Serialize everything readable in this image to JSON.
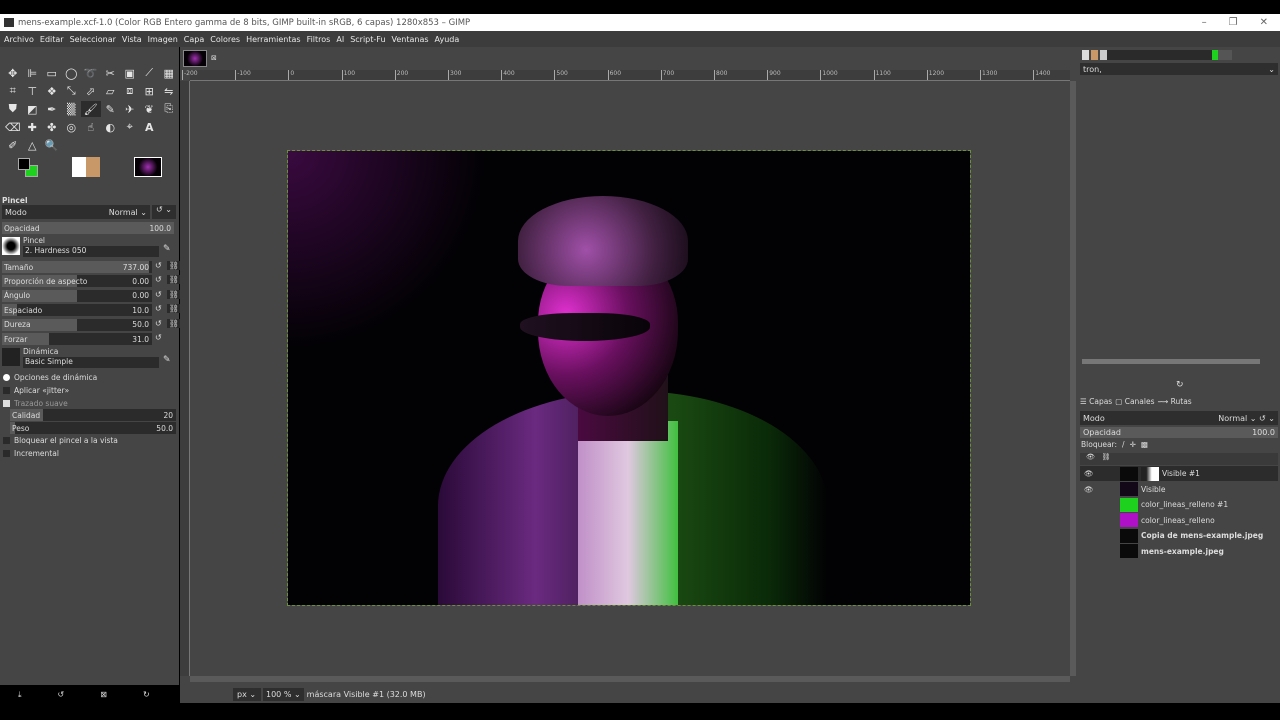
{
  "window": {
    "title": "mens-example.xcf-1.0 (Color RGB Entero gamma de 8 bits, GIMP built-in sRGB, 6 capas) 1280x853 – GIMP",
    "minimize": "–",
    "maximize": "❐",
    "close": "✕"
  },
  "menu": [
    "Archivo",
    "Editar",
    "Seleccionar",
    "Vista",
    "Imagen",
    "Capa",
    "Colores",
    "Herramientas",
    "Filtros",
    "AI",
    "Script-Fu",
    "Ventanas",
    "Ayuda"
  ],
  "tool_options": {
    "title": "Pincel",
    "mode_label": "Modo",
    "mode_value": "Normal",
    "opacity_label": "Opacidad",
    "opacity_value": "100.0",
    "brush_label": "Pincel",
    "brush_value": "2. Hardness 050",
    "sliders": [
      {
        "label": "Tamaño",
        "value": "737.00",
        "fraction": 0.98
      },
      {
        "label": "Proporción de aspecto",
        "value": "0.00",
        "fraction": 0.5
      },
      {
        "label": "Ángulo",
        "value": "0.00",
        "fraction": 0.5
      },
      {
        "label": "Espaciado",
        "value": "10.0",
        "fraction": 0.1
      },
      {
        "label": "Dureza",
        "value": "50.0",
        "fraction": 0.5
      },
      {
        "label": "Forzar",
        "value": "31.0",
        "fraction": 0.31
      }
    ],
    "dynamics_label": "Dinámica",
    "dynamics_value": "Basic Simple",
    "dynamics_options": "Opciones de dinámica",
    "jitter": "Aplicar «jitter»",
    "smooth": "Trazado suave",
    "quality_label": "Calidad",
    "quality_value": "20",
    "quality_fraction": 0.2,
    "weight_label": "Peso",
    "weight_value": "50.0",
    "weight_fraction": 0.03,
    "lock_brush": "Bloquear el pincel a la vista",
    "incremental": "Incremental"
  },
  "ruler": [
    "-200",
    "-100",
    "0",
    "100",
    "200",
    "300",
    "400",
    "500",
    "600",
    "700",
    "800",
    "900",
    "1000",
    "1100",
    "1200",
    "1300",
    "1400"
  ],
  "right_panel": {
    "brush_dropdown": "tron,",
    "tabs": [
      "Capas",
      "Canales",
      "Rutas"
    ],
    "mode_label": "Modo",
    "mode_value": "Normal",
    "opacity_label": "Opacidad",
    "opacity_value": "100.0",
    "lock_label": "Bloquear:",
    "layers": [
      {
        "name": "Visible #1",
        "visible": true,
        "thumb": "#0a0a0a",
        "bold": false
      },
      {
        "name": "Visible",
        "visible": true,
        "thumb": "#120818",
        "bold": false
      },
      {
        "name": "color_lineas_relleno #1",
        "visible": false,
        "thumb": "#1fd11f",
        "bold": false
      },
      {
        "name": "color_lineas_relleno",
        "visible": false,
        "thumb": "#b010c8",
        "bold": false
      },
      {
        "name": "Copia de mens-example.jpeg",
        "visible": false,
        "thumb": "#0a0a0a",
        "bold": true
      },
      {
        "name": "mens-example.jpeg",
        "visible": false,
        "thumb": "#0a0a0a",
        "bold": true
      }
    ]
  },
  "status": {
    "unit": "px",
    "zoom": "100 %",
    "message": "máscara Visible #1 (32.0 MB)"
  },
  "colors": {
    "fg": "#000000",
    "bg": "#1fd11f"
  }
}
